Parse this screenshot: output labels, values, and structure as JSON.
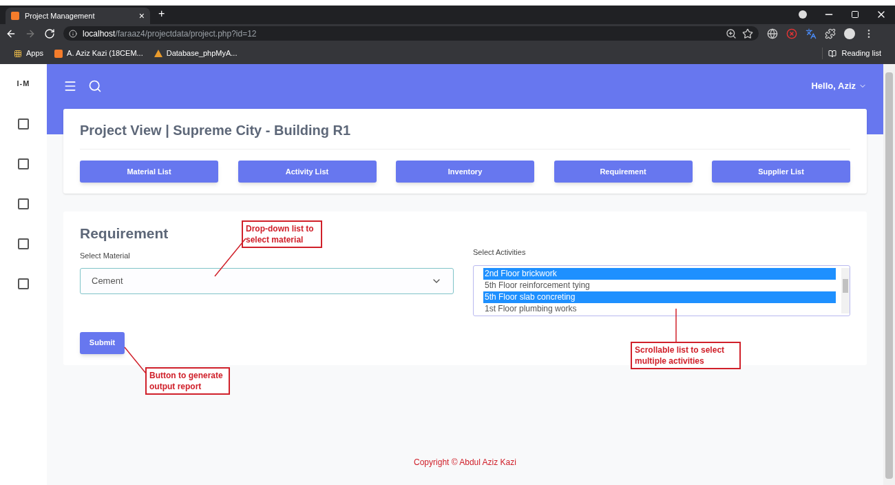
{
  "browser": {
    "tab_title": "Project Management",
    "tab_close": "×",
    "new_tab": "+",
    "url_host": "localhost",
    "url_path": "/faraaz4/projectdata/project.php?id=12",
    "bookmarks": [
      {
        "label": "Apps",
        "kind": "apps"
      },
      {
        "label": "A. Aziz Kazi (18CEM...",
        "kind": "site"
      },
      {
        "label": "Database_phpMyA...",
        "kind": "db"
      }
    ],
    "reading_list": "Reading list"
  },
  "sidebar": {
    "brand": "I-M"
  },
  "header": {
    "greeting": "Hello, Aziz"
  },
  "project": {
    "title": "Project View | Supreme City - Building R1",
    "nav_buttons": [
      "Material List",
      "Activity List",
      "Inventory",
      "Requirement",
      "Supplier List"
    ]
  },
  "requirement": {
    "title": "Requirement",
    "material_label": "Select Material",
    "material_value": "Cement",
    "activities_label": "Select Activities",
    "activities": [
      {
        "label": "2nd Floor brickwork",
        "selected": true
      },
      {
        "label": "5th Floor reinforcement tying",
        "selected": false
      },
      {
        "label": "5th Floor slab concreting",
        "selected": true
      },
      {
        "label": "1st Floor plumbing works",
        "selected": false
      }
    ],
    "submit": "Submit"
  },
  "annotations": [
    "Drop-down list to select material",
    "Scrollable list to select multiple activities",
    "Button to generate output report"
  ],
  "footer": "Copyright © Abdul Aziz Kazi"
}
